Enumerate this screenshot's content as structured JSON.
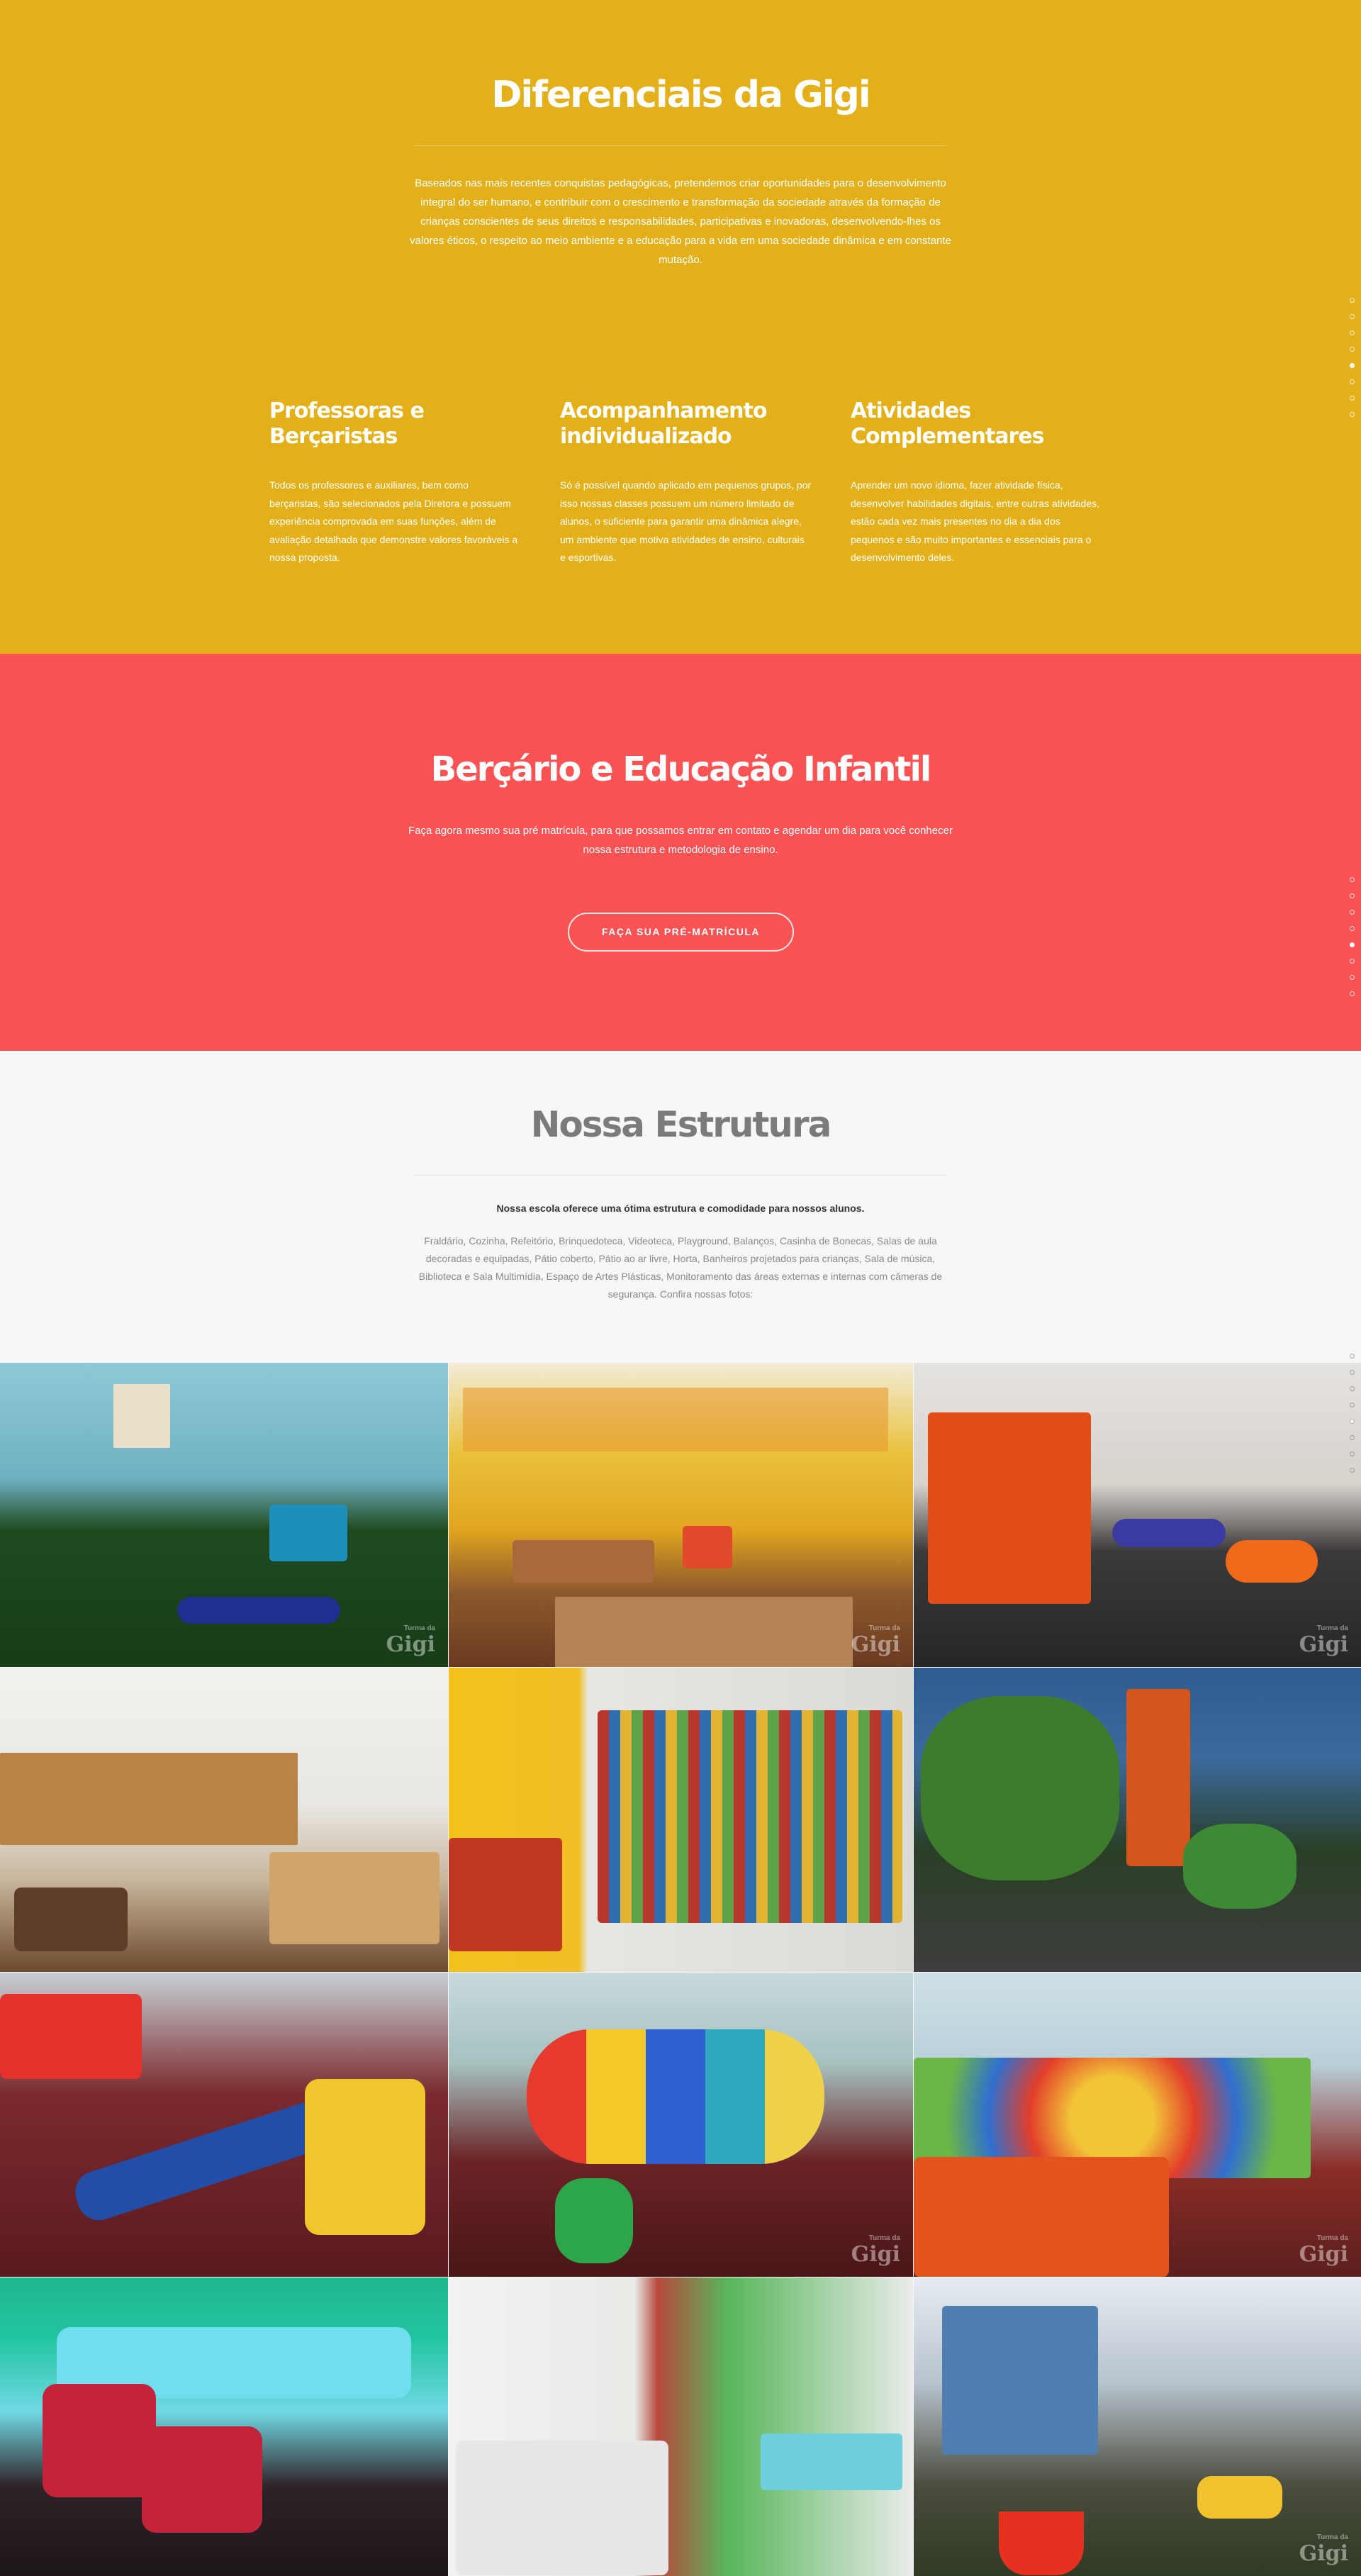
{
  "diferenciais": {
    "title": "Diferenciais da Gigi",
    "intro": "Baseados nas mais recentes conquistas pedagógicas, pretendemos criar oportunidades para o desenvolvimento integral do ser humano, e contribuir com o crescimento e transformação da sociedade através da formação de crianças conscientes de seus direitos e responsabilidades, participativas e inovadoras, desenvolvendo-lhes os valores éticos, o respeito ao meio ambiente e a educação para a vida em uma sociedade dinâmica e em constante mutação.",
    "features": [
      {
        "title": "Professoras e Berçaristas",
        "text": "Todos os professores e auxiliares, bem como berçaristas, são selecionados pela Diretora e possuem experiência comprovada em suas funções, além de avaliação detalhada que demonstre valores favoráveis a nossa proposta."
      },
      {
        "title": "Acompanhamento individualizado",
        "text": "Só é possível quando aplicado em pequenos grupos, por isso nossas classes possuem um número limitado de alunos, o suficiente para garantir uma dinâmica alegre, um ambiente que motiva atividades de ensino, culturais e esportivas."
      },
      {
        "title": "Atividades Complementares",
        "text": "Aprender um novo idioma, fazer atividade física, desenvolver habilidades digitais, entre outras atividades, estão cada vez mais presentes no dia a dia dos pequenos e são muito importantes e essenciais para o desenvolvimento deles."
      }
    ]
  },
  "bercario": {
    "title": "Berçário e Educação Infantil",
    "text": "Faça agora mesmo sua pré matrícula, para que possamos entrar em contato e agendar um dia para você conhecer nossa estrutura e metodologia de ensino.",
    "cta": "FAÇA SUA PRÉ-MATRÍCULA"
  },
  "estrutura": {
    "title": "Nossa Estrutura",
    "lead": "Nossa escola oferece uma ótima estrutura e comodidade para nossos alunos.",
    "desc": "Fraldário, Cozinha, Refeitório, Brinquedoteca, Videoteca, Playground, Balanços, Casinha de Bonecas, Salas de aula decoradas e equipadas, Pátio coberto, Pátio ao ar livre, Horta, Banheiros projetados para crianças, Sala de música, Biblioteca e Sala Multimídia, Espaço de Artes Plásticas, Monitoramento das áreas externas e internas com câmeras de segurança. Confira nossas fotos:"
  },
  "gallery": {
    "watermark_top": "Turma da",
    "watermark": "Gigi",
    "photos": [
      {
        "name": "playground-photo"
      },
      {
        "name": "classroom-photo"
      },
      {
        "name": "dollhouse-photo"
      },
      {
        "name": "shelves-photo"
      },
      {
        "name": "library-photo"
      },
      {
        "name": "plants-photo"
      },
      {
        "name": "slides-photo"
      },
      {
        "name": "tunnel-photo"
      },
      {
        "name": "ballpit-photo"
      },
      {
        "name": "feeding-table-photo"
      },
      {
        "name": "high-chairs-photo"
      },
      {
        "name": "swings-photo"
      }
    ]
  },
  "nav": {
    "dots_count": 8,
    "active_index": 4
  }
}
